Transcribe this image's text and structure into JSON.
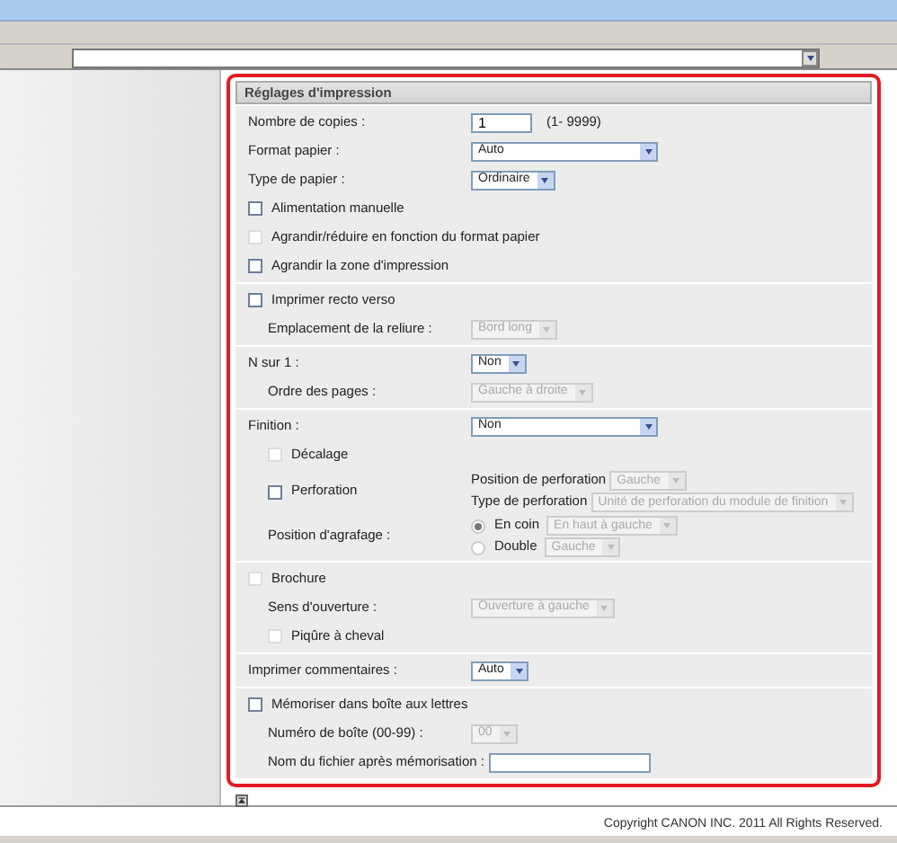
{
  "title": "Réglages d'impression",
  "sections": [
    {
      "rows": [
        {
          "kind": "input",
          "label": "Nombre de copies :",
          "value": "1",
          "hint": "(1- 9999)"
        },
        {
          "kind": "select",
          "label": "Format papier :",
          "value": "Auto",
          "disabled": false,
          "wide": true
        },
        {
          "kind": "select",
          "label": "Type de papier :",
          "value": "Ordinaire",
          "disabled": false
        },
        {
          "kind": "checkbox",
          "label": "Alimentation manuelle",
          "checked": false,
          "disabled": false
        },
        {
          "kind": "checkbox",
          "label": "Agrandir/réduire en fonction du format papier",
          "checked": false,
          "disabled": true
        },
        {
          "kind": "checkbox",
          "label": "Agrandir la zone d'impression",
          "checked": false,
          "disabled": false
        }
      ]
    },
    {
      "rows": [
        {
          "kind": "checkbox",
          "label": "Imprimer recto verso",
          "checked": false,
          "disabled": false,
          "children": [
            {
              "kind": "select",
              "label": "Emplacement de la reliure :",
              "value": "Bord long",
              "disabled": true
            }
          ]
        }
      ]
    },
    {
      "rows": [
        {
          "kind": "select",
          "label": "N sur 1 :",
          "value": "Non",
          "disabled": false,
          "children": [
            {
              "kind": "select",
              "label": "Ordre des pages :",
              "value": "Gauche à droite",
              "disabled": true
            }
          ]
        }
      ]
    },
    {
      "rows": [
        {
          "kind": "select",
          "label": "Finition :",
          "value": "Non",
          "disabled": false,
          "wide": true,
          "children": [
            {
              "kind": "checkbox",
              "label": "Décalage",
              "checked": false,
              "disabled": true
            },
            {
              "kind": "checkbox",
              "label": "Perforation",
              "checked": false,
              "disabled": false,
              "options": [
                {
                  "kind": "select",
                  "label": "Position de perforation",
                  "value": "Gauche",
                  "disabled": true
                },
                {
                  "kind": "select",
                  "label": "Type de perforation",
                  "value": "Unité de perforation du module de finition",
                  "disabled": true
                }
              ]
            },
            {
              "kind": "radio-group",
              "label": "Position d'agrafage :",
              "options": [
                {
                  "kind": "radio",
                  "label": "En coin",
                  "selected": true,
                  "disabled": true,
                  "value": "En haut à gauche"
                },
                {
                  "kind": "radio",
                  "label": "Double",
                  "selected": false,
                  "disabled": true,
                  "value": "Gauche"
                }
              ]
            }
          ]
        }
      ]
    },
    {
      "rows": [
        {
          "kind": "checkbox",
          "label": "Brochure",
          "checked": false,
          "disabled": true,
          "children": [
            {
              "kind": "select",
              "label": "Sens d'ouverture :",
              "value": "Ouverture à gauche",
              "disabled": true
            },
            {
              "kind": "checkbox",
              "label": "Piqûre à cheval",
              "checked": false,
              "disabled": true
            }
          ]
        }
      ]
    },
    {
      "rows": [
        {
          "kind": "select",
          "label": "Imprimer commentaires :",
          "value": "Auto",
          "disabled": false
        }
      ]
    },
    {
      "rows": [
        {
          "kind": "checkbox",
          "label": "Mémoriser dans boîte aux lettres",
          "checked": false,
          "disabled": false,
          "children": [
            {
              "kind": "select",
              "label": "Numéro de boîte (00-99) :",
              "value": "00",
              "disabled": true
            },
            {
              "kind": "input",
              "label": "Nom du fichier après mémorisation :"
            }
          ]
        }
      ]
    }
  ],
  "footer": "Copyright CANON INC. 2011 All Rights Reserved."
}
